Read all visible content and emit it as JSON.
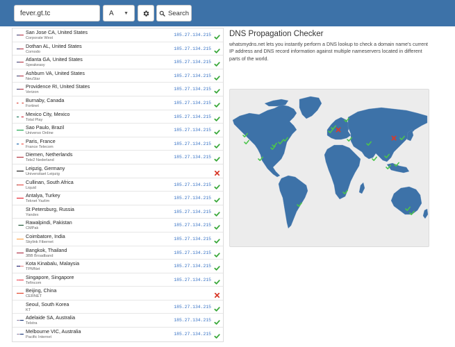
{
  "toolbar": {
    "domain_value": "fever.gt.tc",
    "record_type": "A",
    "search_label": "Search",
    "settings_icon": "gear-icon",
    "search_icon": "search-icon"
  },
  "colors": {
    "header_bg": "#3d72a8",
    "ip_text": "#3873c5",
    "check": "#3aa83a",
    "cross": "#d83a2a",
    "map_land": "#3d72a8",
    "map_bg": "#ececec"
  },
  "results": [
    {
      "location": "San Jose CA, United States",
      "provider": "Corporate West",
      "ip": "185.27.134.215",
      "status": "ok",
      "flag": "us"
    },
    {
      "location": "Dothan AL, United States",
      "provider": "Comodo",
      "ip": "185.27.134.215",
      "status": "ok",
      "flag": "us"
    },
    {
      "location": "Atlanta GA, United States",
      "provider": "Speakeasy",
      "ip": "185.27.134.215",
      "status": "ok",
      "flag": "us"
    },
    {
      "location": "Ashburn VA, United States",
      "provider": "NeuStar",
      "ip": "185.27.134.215",
      "status": "ok",
      "flag": "us"
    },
    {
      "location": "Providence RI, United States",
      "provider": "Verizon",
      "ip": "185.27.134.215",
      "status": "ok",
      "flag": "us"
    },
    {
      "location": "Burnaby, Canada",
      "provider": "Fortinet",
      "ip": "185.27.134.215",
      "status": "ok",
      "flag": "ca"
    },
    {
      "location": "Mexico City, Mexico",
      "provider": "Total Play",
      "ip": "185.27.134.215",
      "status": "ok",
      "flag": "mx"
    },
    {
      "location": "Sao Paulo, Brazil",
      "provider": "Universo Online",
      "ip": "185.27.134.215",
      "status": "ok",
      "flag": "br"
    },
    {
      "location": "Paris, France",
      "provider": "France Telecom",
      "ip": "185.27.134.215",
      "status": "ok",
      "flag": "fr"
    },
    {
      "location": "Diemen, Netherlands",
      "provider": "Tele2 Nederland",
      "ip": "185.27.134.215",
      "status": "ok",
      "flag": "nl"
    },
    {
      "location": "Leipzig, Germany",
      "provider": "Universitaet Leipzig",
      "ip": "",
      "status": "fail",
      "flag": "de"
    },
    {
      "location": "Cullinan, South Africa",
      "provider": "Liquid",
      "ip": "185.27.134.215",
      "status": "ok",
      "flag": "za"
    },
    {
      "location": "Antalya, Turkey",
      "provider": "Teknet Yazlim",
      "ip": "185.27.134.215",
      "status": "ok",
      "flag": "tr"
    },
    {
      "location": "St Petersburg, Russia",
      "provider": "Yandex",
      "ip": "185.27.134.215",
      "status": "ok",
      "flag": "ru"
    },
    {
      "location": "Rawalpindi, Pakistan",
      "provider": "CMPak",
      "ip": "185.27.134.215",
      "status": "ok",
      "flag": "pk"
    },
    {
      "location": "Coimbatore, India",
      "provider": "Skylink Fibernet",
      "ip": "185.27.134.215",
      "status": "ok",
      "flag": "in"
    },
    {
      "location": "Bangkok, Thailand",
      "provider": "3BB Broadband",
      "ip": "185.27.134.215",
      "status": "ok",
      "flag": "th"
    },
    {
      "location": "Kota Kinabalu, Malaysia",
      "provider": "TPMNet",
      "ip": "185.27.134.215",
      "status": "ok",
      "flag": "my"
    },
    {
      "location": "Singapore, Singapore",
      "provider": "Tefincom",
      "ip": "185.27.134.215",
      "status": "ok",
      "flag": "sg"
    },
    {
      "location": "Beijing, China",
      "provider": "CERNET",
      "ip": "",
      "status": "fail",
      "flag": "cn"
    },
    {
      "location": "Seoul, South Korea",
      "provider": "KT",
      "ip": "185.27.134.215",
      "status": "ok",
      "flag": "kr"
    },
    {
      "location": "Adelaide SA, Australia",
      "provider": "Telstra",
      "ip": "185.27.134.215",
      "status": "ok",
      "flag": "au"
    },
    {
      "location": "Melbourne VIC, Australia",
      "provider": "Pacific Internet",
      "ip": "185.27.134.215",
      "status": "ok",
      "flag": "au"
    }
  ],
  "info": {
    "title": "DNS Propagation Checker",
    "description": "whatsmydns.net lets you instantly perform a DNS lookup to check a domain name's current IP address and DNS record information against multiple nameservers located in different parts of the world."
  },
  "map": {
    "markers": [
      {
        "location": "San Jose CA, United States",
        "status": "ok"
      },
      {
        "location": "Dothan AL, United States",
        "status": "ok"
      },
      {
        "location": "Atlanta GA, United States",
        "status": "ok"
      },
      {
        "location": "Ashburn VA, United States",
        "status": "ok"
      },
      {
        "location": "Providence RI, United States",
        "status": "ok"
      },
      {
        "location": "Burnaby, Canada",
        "status": "ok"
      },
      {
        "location": "Mexico City, Mexico",
        "status": "ok"
      },
      {
        "location": "Sao Paulo, Brazil",
        "status": "ok"
      },
      {
        "location": "Paris, France",
        "status": "ok"
      },
      {
        "location": "Diemen, Netherlands",
        "status": "ok"
      },
      {
        "location": "Leipzig, Germany",
        "status": "fail"
      },
      {
        "location": "Cullinan, South Africa",
        "status": "ok"
      },
      {
        "location": "Antalya, Turkey",
        "status": "ok"
      },
      {
        "location": "St Petersburg, Russia",
        "status": "ok"
      },
      {
        "location": "Rawalpindi, Pakistan",
        "status": "ok"
      },
      {
        "location": "Coimbatore, India",
        "status": "ok"
      },
      {
        "location": "Bangkok, Thailand",
        "status": "ok"
      },
      {
        "location": "Kota Kinabalu, Malaysia",
        "status": "ok"
      },
      {
        "location": "Singapore, Singapore",
        "status": "ok"
      },
      {
        "location": "Beijing, China",
        "status": "fail"
      },
      {
        "location": "Seoul, South Korea",
        "status": "ok"
      },
      {
        "location": "Adelaide SA, Australia",
        "status": "ok"
      },
      {
        "location": "Melbourne VIC, Australia",
        "status": "ok"
      }
    ]
  }
}
